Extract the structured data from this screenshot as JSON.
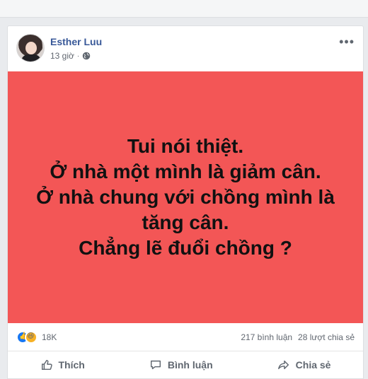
{
  "post": {
    "author": "Esther Luu",
    "time": "13 giờ",
    "poster_bg": "#f35656",
    "poster_lines": [
      "Tui nói thiệt.",
      "Ở nhà một mình là giảm cân.",
      "Ở nhà chung với chồng mình là",
      "tăng cân.",
      "Chẳng lẽ đuổi chồng ?"
    ],
    "reactions_count": "18K",
    "comments": "217 bình luận",
    "shares": "28 lượt chia sẻ",
    "actions": {
      "like": "Thích",
      "comment": "Bình luận",
      "share": "Chia sẻ"
    }
  },
  "icons": {
    "privacy": "globe-icon",
    "menu": "more-icon",
    "reactions": [
      "like-reaction-icon",
      "haha-reaction-icon"
    ],
    "like_action": "like-thumb-icon",
    "comment_action": "comment-bubble-icon",
    "share_action": "share-arrow-icon"
  }
}
